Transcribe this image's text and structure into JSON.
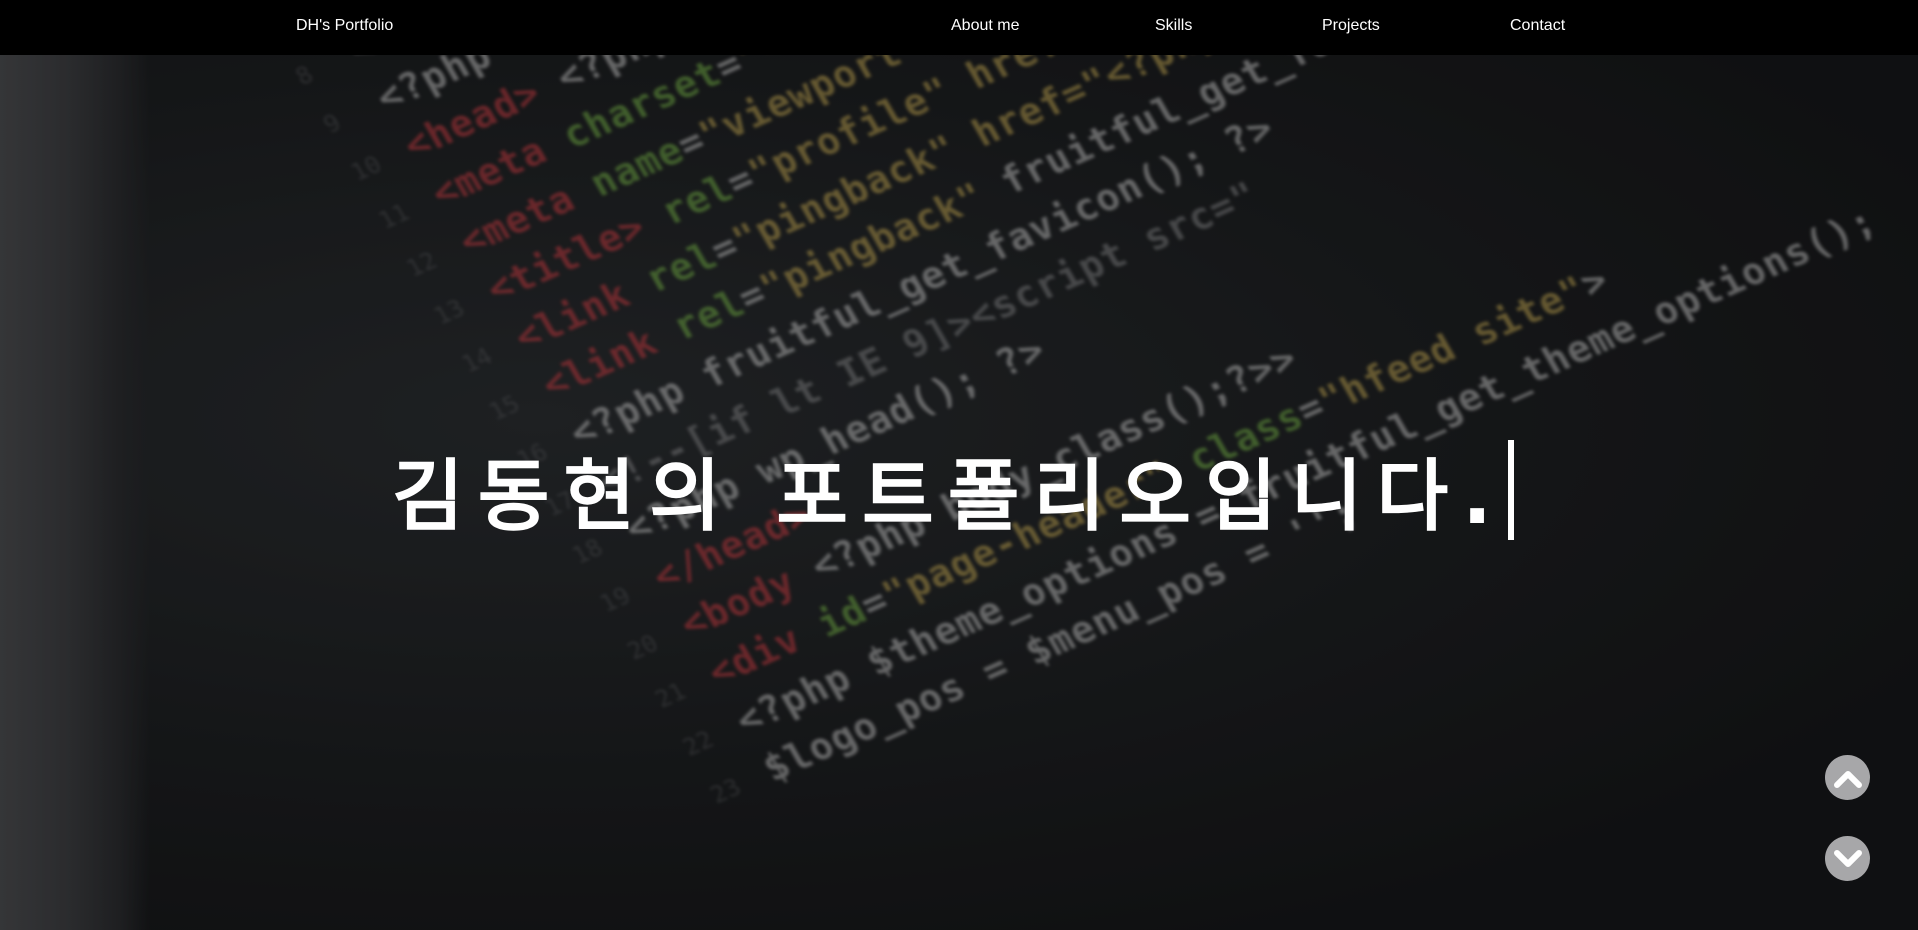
{
  "navbar": {
    "brand": "DH's Portfolio",
    "links": [
      {
        "label": "About me"
      },
      {
        "label": "Skills"
      },
      {
        "label": "Projects"
      },
      {
        "label": "Contact"
      }
    ]
  },
  "hero": {
    "title": "김동현의 포트폴리오입니다."
  },
  "scroll_controls": {
    "up_icon": "chevron-up-icon",
    "down_icon": "chevron-down-icon"
  },
  "colors": {
    "navbar_bg": "#000000",
    "text": "#ffffff",
    "scroll_button_bg": "#a7a7a9",
    "code_red": "#d9434a",
    "code_green": "#7fbf4f",
    "code_yellow": "#d1b45b"
  }
}
